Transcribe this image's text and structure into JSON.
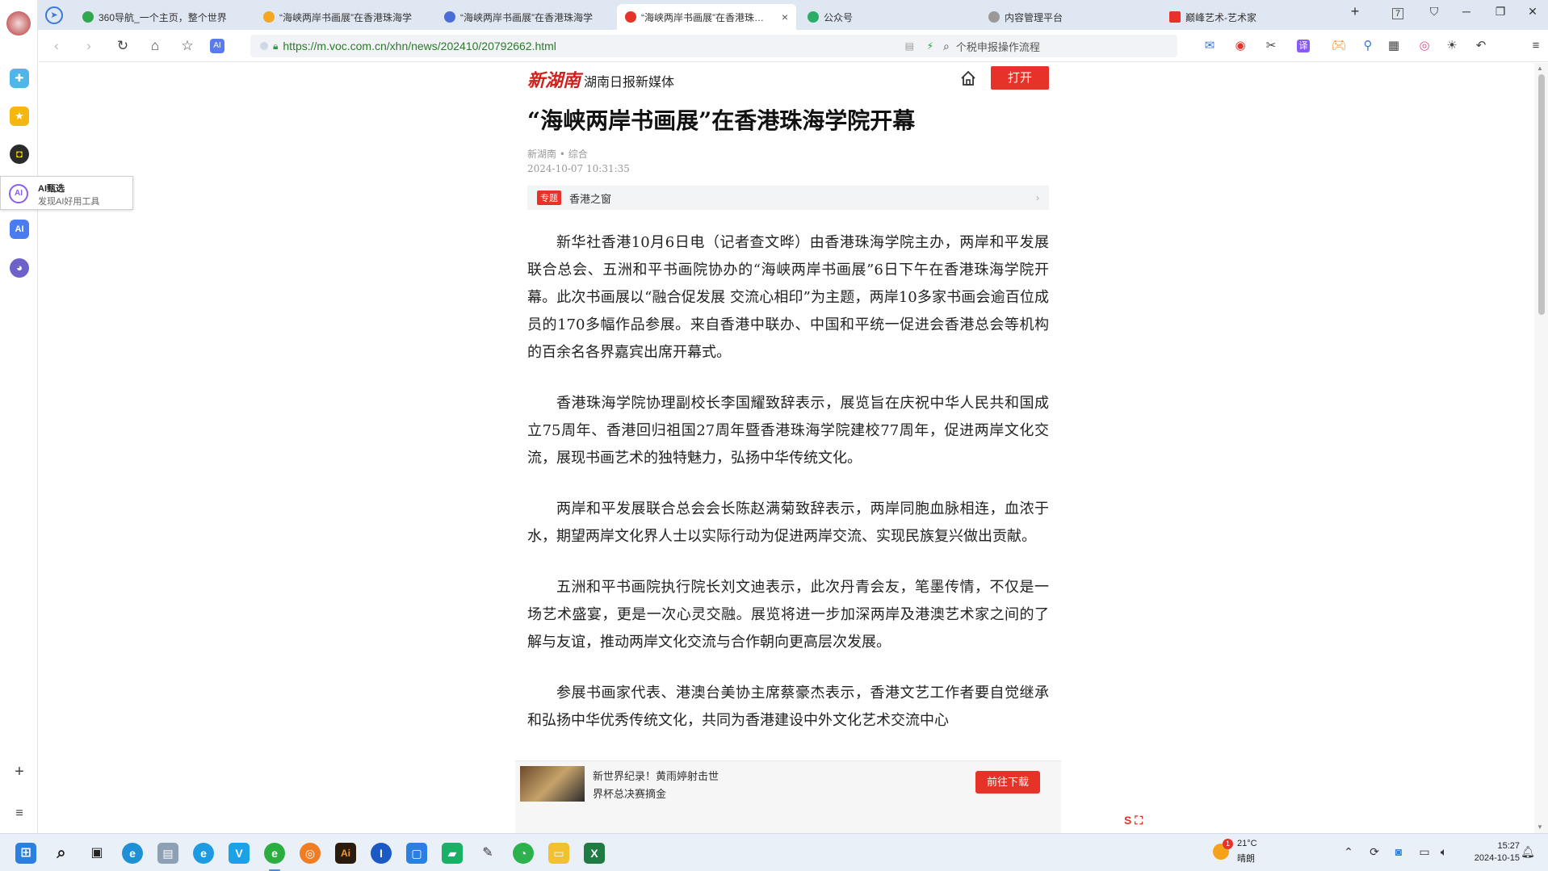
{
  "tabs": [
    {
      "label": "360导航_一个主页，整个世界",
      "active": false,
      "color": "#2fa84f"
    },
    {
      "label": "“海峡两岸书画展”在香港珠海学",
      "active": false,
      "color": "#f5a623"
    },
    {
      "label": "“海峡两岸书画展”在香港珠海学",
      "active": false,
      "color": "#4b6ed6"
    },
    {
      "label": "“海峡两岸书画展”在香港珠海学",
      "active": true,
      "color": "#e7322a"
    },
    {
      "label": "公众号",
      "active": false,
      "color": "#2aae67"
    },
    {
      "label": "内容管理平台",
      "active": false,
      "color": "#999999"
    },
    {
      "label": "巅峰艺术-艺术家",
      "active": false,
      "color": "#e7322a"
    }
  ],
  "tab_close": "×",
  "tab_new": "+",
  "window": {
    "counter": "7",
    "minimize": "─",
    "restore": "❐",
    "close": "✕"
  },
  "toolbar": {
    "url": "https://m.voc.com.cn/xhn/news/202410/20792662.html",
    "search_placeholder": "个税申报操作流程"
  },
  "sidebar": {
    "popup_title": "AI甄选",
    "popup_subtitle": "发现AI好用工具",
    "add": "+",
    "list": "≡"
  },
  "site": {
    "logo": "新湖南",
    "name": "湖南日报新媒体",
    "open_button": "打开"
  },
  "article": {
    "title": "“海峡两岸书画展”在香港珠海学院开幕",
    "source": "新湖南 • 综合",
    "datetime": "2024-10-07 10:31:35",
    "topic_tag": "专题",
    "topic_name": "香港之窗",
    "paragraphs": [
      "新华社香港10月6日电（记者查文晔）由香港珠海学院主办，两岸和平发展联合总会、五洲和平书画院协办的“海峡两岸书画展”6日下午在香港珠海学院开幕。此次书画展以“融合促发展 交流心相印”为主题，两岸10多家书画会逾百位成员的170多幅作品参展。来自香港中联办、中国和平统一促进会香港总会等机构的百余名各界嘉宾出席开幕式。",
      "香港珠海学院协理副校长李国耀致辞表示，展览旨在庆祝中华人民共和国成立75周年、香港回归祖国27周年暨香港珠海学院建校77周年，促进两岸文化交流，展现书画艺术的独特魅力，弘扬中华传统文化。",
      "两岸和平发展联合总会会长陈赵满菊致辞表示，两岸同胞血脉相连，血浓于水，期望两岸文化界人士以实际行动为促进两岸交流、实现民族复兴做出贡献。",
      "五洲和平书画院执行院长刘文迪表示，此次丹青会友，笔墨传情，不仅是一场艺术盛宴，更是一次心灵交融。展览将进一步加深两岸及港澳艺术家之间的了解与友谊，推动两岸文化交流与合作朝向更高层次发展。",
      "参展书画家代表、港澳台美协主席蔡豪杰表示，香港文艺工作者要自觉继承和弘扬中华优秀传统文化，共同为香港建设中外文化艺术交流中心"
    ]
  },
  "banner": {
    "line1": "新世界纪录！黄雨婷射击世",
    "line2": "界杯总决赛摘金",
    "download": "前往下载"
  },
  "taskbar": {
    "weather_badge": "1",
    "temperature": "21°C",
    "condition": "晴朗",
    "time": "15:27",
    "date": "2024-10-15"
  }
}
